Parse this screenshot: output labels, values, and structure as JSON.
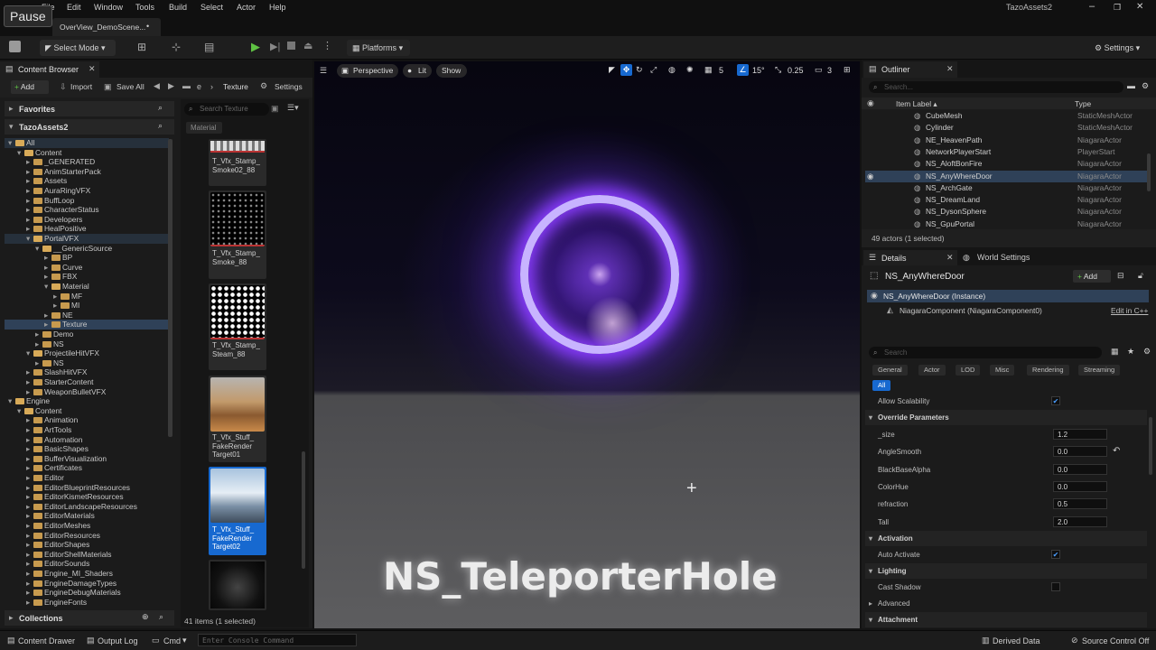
{
  "pause_label": "Pause",
  "menu": [
    "File",
    "Edit",
    "Window",
    "Tools",
    "Build",
    "Select",
    "Actor",
    "Help"
  ],
  "project_name": "TazoAssets2",
  "level_tab": "OverView_DemoScene...",
  "level_tab_mark": "•",
  "toolbar": {
    "select_mode": "Select Mode",
    "platforms": "Platforms",
    "settings": "Settings"
  },
  "content_browser": {
    "tab": "Content Browser",
    "add": "Add",
    "import": "Import",
    "save_all": "Save All",
    "crumb_dots": "e",
    "crumb_current": "Texture",
    "settings": "Settings",
    "favorites": "Favorites",
    "project": "TazoAssets2",
    "search_placeholder": "Search Texture",
    "filter_chip": "Material",
    "tree": [
      "All",
      "Content",
      "_GENERATED",
      "AnimStarterPack",
      "Assets",
      "AuraRingVFX",
      "BuffLoop",
      "CharacterStatus",
      "Developers",
      "HealPositive",
      "PortalVFX",
      "__GenericSource",
      "BP",
      "Curve",
      "FBX",
      "Material",
      "MF",
      "MI",
      "NE",
      "Texture",
      "Demo",
      "NS",
      "ProjectileHitVFX",
      "NS",
      "SlashHitVFX",
      "StarterContent",
      "WeaponBulletVFX",
      "Engine",
      "Content",
      "Animation",
      "ArtTools",
      "Automation",
      "BasicShapes",
      "BufferVisualization",
      "Certificates",
      "Editor",
      "EditorBlueprintResources",
      "EditorKismetResources",
      "EditorLandscapeResources",
      "EditorMaterials",
      "EditorMeshes",
      "EditorResources",
      "EditorShapes",
      "EditorShellMaterials",
      "EditorSounds",
      "Engine_MI_Shaders",
      "EngineDamageTypes",
      "EngineDebugMaterials",
      "EngineFonts"
    ],
    "assets": [
      "T_Vfx_Stamp_\nSmoke02_88",
      "T_Vfx_Stamp_\nSmoke_88",
      "T_Vfx_Stamp_\nSteam_88",
      "T_Vfx_Stuff_\nFakeRender\nTarget01",
      "T_Vfx_Stuff_\nFakeRender\nTarget02"
    ],
    "item_count": "41 items (1 selected)",
    "collections": "Collections"
  },
  "viewport": {
    "perspective": "Perspective",
    "lit": "Lit",
    "show": "Show",
    "grid": "5",
    "angle": "15°",
    "scale": "0.25",
    "cam": "3",
    "caption": "NS_TeleporterHole"
  },
  "outliner": {
    "tab": "Outliner",
    "search_placeholder": "Search...",
    "col_label": "Item Label",
    "col_type": "Type",
    "rows": [
      {
        "label": "CubeMesh",
        "type": "StaticMeshActor"
      },
      {
        "label": "Cylinder",
        "type": "StaticMeshActor"
      },
      {
        "label": "NE_HeavenPath",
        "type": "NiagaraActor"
      },
      {
        "label": "NetworkPlayerStart",
        "type": "PlayerStart"
      },
      {
        "label": "NS_AloftBonFire",
        "type": "NiagaraActor"
      },
      {
        "label": "NS_AnyWhereDoor",
        "type": "NiagaraActor"
      },
      {
        "label": "NS_ArchGate",
        "type": "NiagaraActor"
      },
      {
        "label": "NS_DreamLand",
        "type": "NiagaraActor"
      },
      {
        "label": "NS_DysonSphere",
        "type": "NiagaraActor"
      },
      {
        "label": "NS_GpuPortal",
        "type": "NiagaraActor"
      }
    ],
    "footer": "49 actors (1 selected)"
  },
  "details": {
    "tab": "Details",
    "tab2": "World Settings",
    "object": "NS_AnyWhereDoor",
    "add": "Add",
    "instance": "NS_AnyWhereDoor (Instance)",
    "component": "NiagaraComponent (NiagaraComponent0)",
    "edit_cpp": "Edit in C++",
    "search_placeholder": "Search",
    "filters": [
      "General",
      "Actor",
      "LOD",
      "Misc",
      "Rendering",
      "Streaming"
    ],
    "filter_all": "All",
    "allow_scalability": "Allow Scalability",
    "override_cat": "Override Parameters",
    "params": [
      {
        "name": "_size",
        "value": "1.2"
      },
      {
        "name": "AngleSmooth",
        "value": "0.0"
      },
      {
        "name": "BlackBaseAlpha",
        "value": "0.0"
      },
      {
        "name": "ColorHue",
        "value": "0.0"
      },
      {
        "name": "refraction",
        "value": "0.5"
      },
      {
        "name": "Tall",
        "value": "2.0"
      }
    ],
    "activation_cat": "Activation",
    "auto_activate": "Auto Activate",
    "lighting_cat": "Lighting",
    "cast_shadow": "Cast Shadow",
    "advanced": "Advanced",
    "attachment_cat": "Attachment"
  },
  "statusbar": {
    "content_drawer": "Content Drawer",
    "output_log": "Output Log",
    "cmd": "Cmd",
    "console_placeholder": "Enter Console Command",
    "derived_data": "Derived Data",
    "source_control": "Source Control Off"
  }
}
